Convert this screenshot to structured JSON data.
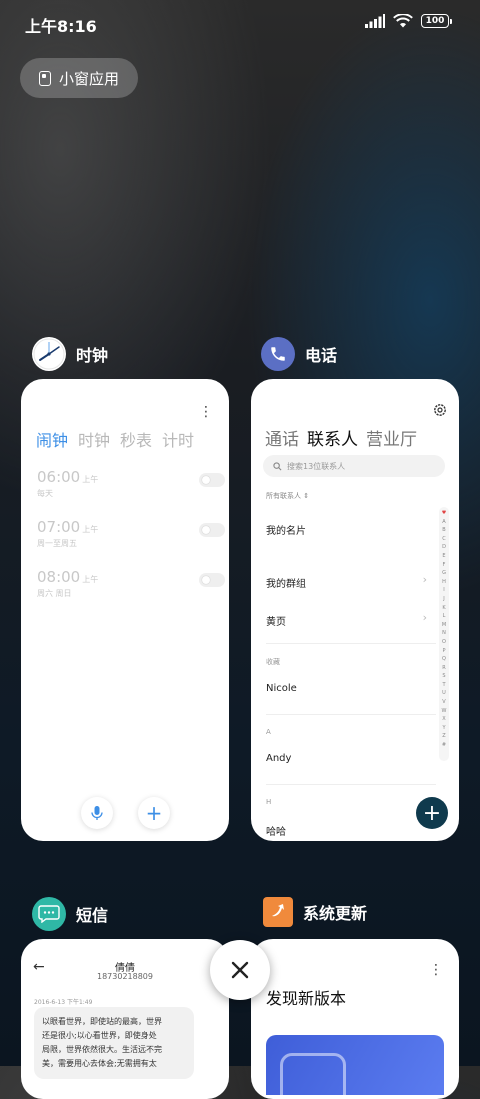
{
  "status_bar": {
    "time": "上午8:16",
    "battery": "100"
  },
  "mini_window": {
    "label": "小窗应用"
  },
  "clock_card": {
    "title": "时钟",
    "tabs": [
      "闹钟",
      "时钟",
      "秒表",
      "计时"
    ],
    "alarms": [
      {
        "time": "06:00",
        "ampm": "上午",
        "repeat": "每天"
      },
      {
        "time": "07:00",
        "ampm": "上午",
        "repeat": "周一至周五"
      },
      {
        "time": "08:00",
        "ampm": "上午",
        "repeat": "周六 周日"
      }
    ],
    "menu_glyph": "⋮",
    "add_glyph": "+"
  },
  "phone_card": {
    "title": "电话",
    "tabs": [
      "通话",
      "联系人",
      "营业厅"
    ],
    "search_placeholder": "搜索13位联系人",
    "all_contacts": "所有联系人 ⇕",
    "my_card": "我的名片",
    "my_groups": "我的群组",
    "yellow_pages": "黄页",
    "favorites_label": "收藏",
    "favorite_contact": "Nicole",
    "section_a": "A",
    "contact_a": "Andy",
    "section_h": "H",
    "contact_h": "哈哈",
    "alpha_index": [
      "♥",
      "A",
      "B",
      "C",
      "D",
      "E",
      "F",
      "G",
      "H",
      "I",
      "J",
      "K",
      "L",
      "M",
      "N",
      "O",
      "P",
      "Q",
      "R",
      "S",
      "T",
      "U",
      "V",
      "W",
      "X",
      "Y",
      "Z",
      "#"
    ],
    "add_glyph": "+",
    "chevron": "›"
  },
  "sms_card": {
    "title": "短信",
    "back_glyph": "←",
    "contact_name": "倩倩",
    "contact_number": "18730218809",
    "date": "2016-6-13 下午1:49",
    "message_lines": [
      "以眼看世界，即使站的最高，世界",
      "还是很小;以心看世界，即使身处",
      "局限，世界依然很大。生活远不完",
      "美，需要用心去体会;无需拥有太"
    ]
  },
  "update_card": {
    "title": "系统更新",
    "heading": "发现新版本",
    "menu_glyph": "⋮"
  },
  "close_glyph": "✕"
}
